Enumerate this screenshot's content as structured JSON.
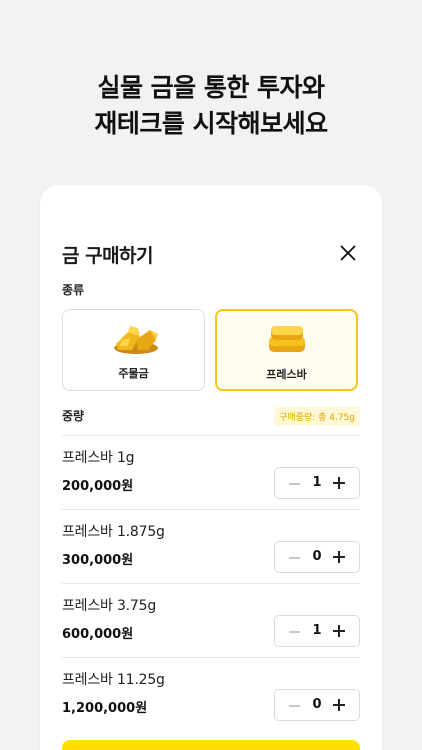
{
  "headline": {
    "line1": "실물 금을 통한 투자와",
    "line2": "재테크를 시작해보세요"
  },
  "modal": {
    "title": "금 구매하기",
    "type_label": "종류",
    "types": [
      {
        "label": "주물금",
        "selected": false,
        "icon": "gold-nugget-icon"
      },
      {
        "label": "프레스바",
        "selected": true,
        "icon": "press-bar-icon"
      }
    ],
    "weight_label": "중량",
    "weight_badge": "구매중량: 총 4.75g",
    "items": [
      {
        "name": "프레스바 1g",
        "price": "200,000원",
        "qty": "1"
      },
      {
        "name": "프레스바 1.875g",
        "price": "300,000원",
        "qty": "0"
      },
      {
        "name": "프레스바 3.75g",
        "price": "600,000원",
        "qty": "1"
      },
      {
        "name": "프레스바 11.25g",
        "price": "1,200,000원",
        "qty": "0"
      }
    ]
  },
  "colors": {
    "accent": "#ffde00",
    "selected_border": "#f5c518",
    "badge_text": "#e0a400",
    "background": "#f2f2f2"
  }
}
